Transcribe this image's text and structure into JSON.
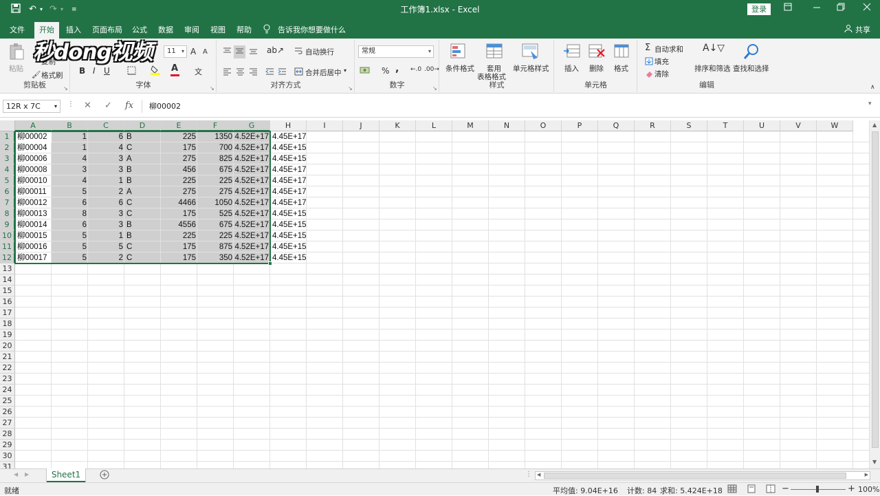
{
  "window": {
    "title": "工作簿1.xlsx  -  Excel",
    "login_label": "登录"
  },
  "tabs": [
    "文件",
    "开始",
    "插入",
    "页面布局",
    "公式",
    "数据",
    "审阅",
    "视图",
    "帮助"
  ],
  "tell_me": "告诉我你想要做什么",
  "share": "共享",
  "watermark": "秒dong视频",
  "ribbon": {
    "clipboard": {
      "label": "剪贴板",
      "paste": "粘贴",
      "copy": "复制",
      "format_painter": "格式刷"
    },
    "font": {
      "label": "字体",
      "size": "11",
      "bold": "B",
      "italic": "I",
      "underline": "U",
      "grow": "A",
      "shrink": "A",
      "font_color_glyph": "A"
    },
    "alignment": {
      "label": "对齐方式",
      "wrap": "自动换行",
      "merge": "合并后居中"
    },
    "number": {
      "label": "数字",
      "format": "常规",
      "percent": "%",
      "comma": ","
    },
    "styles": {
      "label": "样式",
      "conditional": "条件格式",
      "table_line1": "套用",
      "table_line2": "表格格式",
      "cell_styles": "单元格样式"
    },
    "cells": {
      "label": "单元格",
      "insert": "插入",
      "delete": "删除",
      "format": "格式"
    },
    "editing": {
      "label": "编辑",
      "autosum": "自动求和",
      "fill": "填充",
      "clear": "清除",
      "sort": "排序和筛选",
      "find": "查找和选择"
    }
  },
  "formula_bar": {
    "name_box": "12R x 7C",
    "fx": "fx",
    "value": "柳00002"
  },
  "columns": [
    "A",
    "B",
    "C",
    "D",
    "E",
    "F",
    "G",
    "H",
    "I",
    "J",
    "K",
    "L",
    "M",
    "N",
    "O",
    "P",
    "Q",
    "R",
    "S",
    "T",
    "U",
    "V",
    "W"
  ],
  "rows": [
    "1",
    "2",
    "3",
    "4",
    "5",
    "6",
    "7",
    "8",
    "9",
    "10",
    "11",
    "12",
    "13",
    "14",
    "15",
    "16",
    "17",
    "18",
    "19",
    "20",
    "21",
    "22",
    "23",
    "24",
    "25",
    "26",
    "27",
    "28",
    "29",
    "30",
    "31"
  ],
  "data_rows": [
    [
      "柳00002",
      "1",
      "6",
      "B",
      "225",
      "1350",
      "4.52E+17",
      "4.45E+17"
    ],
    [
      "柳00004",
      "1",
      "4",
      "C",
      "175",
      "700",
      "4.52E+17",
      "4.45E+15"
    ],
    [
      "柳00006",
      "4",
      "3",
      "A",
      "275",
      "825",
      "4.52E+17",
      "4.45E+15"
    ],
    [
      "柳00008",
      "3",
      "3",
      "B",
      "456",
      "675",
      "4.52E+17",
      "4.45E+17"
    ],
    [
      "柳00010",
      "4",
      "1",
      "B",
      "225",
      "225",
      "4.52E+17",
      "4.45E+17"
    ],
    [
      "柳00011",
      "5",
      "2",
      "A",
      "275",
      "275",
      "4.52E+17",
      "4.45E+17"
    ],
    [
      "柳00012",
      "6",
      "6",
      "C",
      "4466",
      "1050",
      "4.52E+17",
      "4.45E+17"
    ],
    [
      "柳00013",
      "8",
      "3",
      "C",
      "175",
      "525",
      "4.52E+17",
      "4.45E+15"
    ],
    [
      "柳00014",
      "6",
      "3",
      "B",
      "4556",
      "675",
      "4.52E+17",
      "4.45E+15"
    ],
    [
      "柳00015",
      "5",
      "1",
      "B",
      "225",
      "225",
      "4.52E+17",
      "4.45E+15"
    ],
    [
      "柳00016",
      "5",
      "5",
      "C",
      "175",
      "875",
      "4.52E+17",
      "4.45E+15"
    ],
    [
      "柳00017",
      "5",
      "2",
      "C",
      "175",
      "350",
      "4.52E+17",
      "4.45E+15"
    ]
  ],
  "sheet_tab": "Sheet1",
  "status": {
    "mode": "就绪",
    "average": "平均值: 9.04E+16",
    "count": "计数: 84",
    "sum": "求和: 5.424E+18",
    "zoom": "100%"
  },
  "colors": {
    "excel_green": "#217346",
    "selection_fill": "#cfcfcf"
  }
}
